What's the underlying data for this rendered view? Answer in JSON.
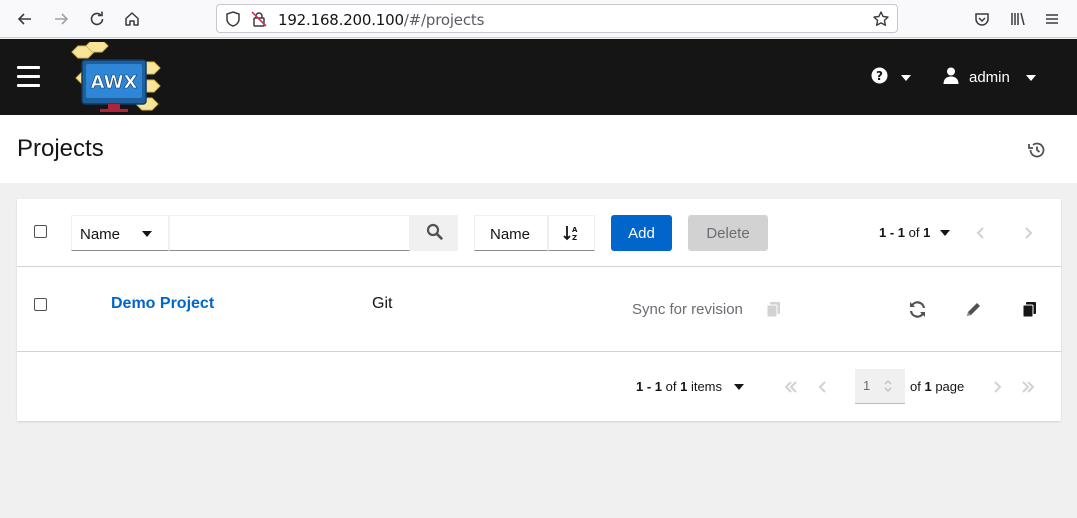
{
  "browser": {
    "url_host": "192.168.200.100",
    "url_path": "/#/projects"
  },
  "masthead": {
    "logo_text": "AWX",
    "user_name": "admin"
  },
  "page": {
    "title": "Projects"
  },
  "toolbar": {
    "filter_field": "Name",
    "search_placeholder": "",
    "sort_field": "Name",
    "add_label": "Add",
    "delete_label": "Delete",
    "pagination_start": "1 - 1",
    "pagination_of": " of ",
    "pagination_total": "1"
  },
  "projects": [
    {
      "name": "Demo Project",
      "scm_type": "Git",
      "revision_label": "Sync for revision"
    }
  ],
  "footer": {
    "items_range": "1 - 1",
    "items_of": " of ",
    "items_total": "1",
    "items_label": " items",
    "current_page": "1",
    "of_page_prefix": "of ",
    "page_count": "1",
    "page_suffix": " page"
  },
  "colors": {
    "masthead_bg": "#151515",
    "primary": "#0066cc",
    "disabled_bg": "#d2d2d2",
    "page_bg": "#f0f0f0"
  },
  "icons": [
    "back-icon",
    "forward-icon",
    "reload-icon",
    "home-icon",
    "shield-icon",
    "insecure-lock-icon",
    "bookmark-star-icon",
    "pocket-icon",
    "library-icon",
    "menu-icon",
    "hamburger-icon",
    "help-icon",
    "user-icon",
    "history-icon",
    "search-icon",
    "sort-alpha-icon",
    "copy-icon",
    "sync-icon",
    "edit-icon"
  ]
}
